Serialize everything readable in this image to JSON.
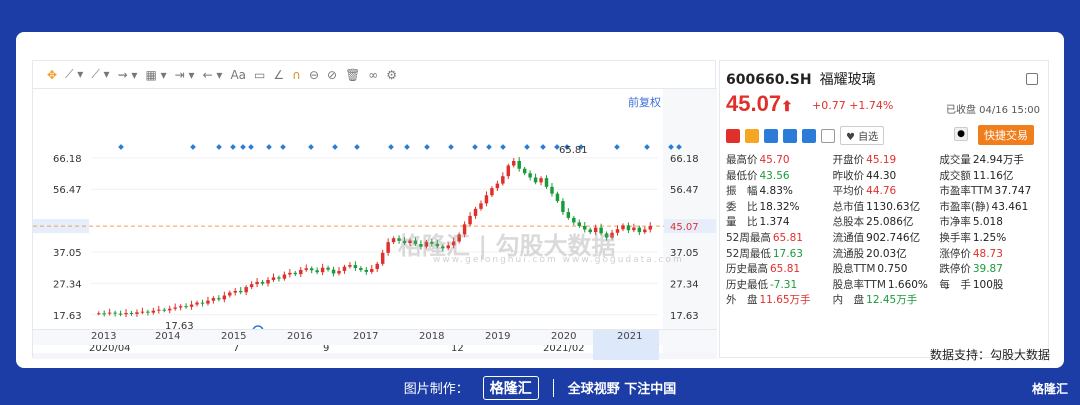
{
  "toolbar": {
    "items": [
      "✥",
      "⟋ ▾",
      "⟋ ▾",
      "⇝ ▾",
      "▦ ▾",
      "⇥ ▾",
      "← ▾",
      "Aa",
      "▭",
      "∠",
      "∩",
      "⊖",
      "⊘",
      "🗑",
      "∞",
      "⚙"
    ],
    "forward_adjust": "前复权"
  },
  "chart_data": {
    "type": "candlestick",
    "y_ticks": [
      "66.18",
      "56.47",
      "45.07",
      "37.05",
      "27.34",
      "17.63"
    ],
    "y_ticks_right": [
      "66.18",
      "56.47",
      "45.07",
      "37.05",
      "27.34",
      "17.63"
    ],
    "current_price_label": "45.07",
    "high_label": "65.81",
    "low_label": "17.63",
    "x_ticks": [
      "2020/04",
      "7",
      "9",
      "12",
      "2021/02"
    ],
    "timeline_years": [
      "2013",
      "2014",
      "2015",
      "2016",
      "2017",
      "2018",
      "2019",
      "2020",
      "2021"
    ],
    "ylim": [
      12,
      72
    ],
    "series": [
      {
        "close": [
          18.1,
          18.0,
          18.3,
          18.0,
          17.8,
          18.2,
          17.9,
          18.4,
          18.6,
          18.3,
          18.9,
          19.2,
          19.0,
          19.5,
          19.9,
          20.3,
          20.1,
          20.8,
          21.4,
          21.1,
          22.0,
          22.8,
          22.4,
          23.6,
          24.5,
          25.0,
          24.6,
          26.2,
          27.1,
          27.8,
          27.3,
          28.4,
          29.2,
          28.8,
          30.1,
          30.6,
          30.2,
          31.5,
          32.0,
          31.4,
          30.8,
          32.2,
          31.6,
          30.4,
          31.2,
          32.5,
          33.0,
          32.1,
          31.5,
          30.9,
          31.8,
          33.4,
          36.8,
          40.1,
          41.3,
          40.5,
          39.8,
          40.6,
          39.5,
          38.7,
          40.2,
          39.6,
          38.8,
          38.2,
          39.1,
          40.3,
          42.5,
          45.6,
          48.2,
          50.4,
          52.1,
          54.6,
          56.8,
          58.2,
          60.5,
          63.8,
          65.2,
          62.8,
          61.4,
          60.1,
          58.6,
          59.9,
          57.2,
          55.1,
          52.8,
          49.4,
          47.6,
          46.2,
          45.1,
          44.0,
          43.2,
          44.6,
          42.8,
          41.5,
          43.0,
          44.1,
          45.3,
          43.8,
          44.6,
          43.2,
          44.0,
          45.07
        ]
      }
    ]
  },
  "watermark": {
    "main": "格隆汇 | 勾股大数据",
    "sub": "www.gelonghui.com   www.gogudata.com"
  },
  "info": {
    "code": "600660.SH",
    "name": "福耀玻璃",
    "price": "45.07",
    "arrow": "⬆",
    "change": "+0.77",
    "change_pct": "+1.74%",
    "status": "已收盘 04/16 15:00",
    "watch_label": "♥ 自选",
    "trade_label": "快捷交易",
    "rows": [
      [
        [
          "最高价",
          "45.70",
          "red"
        ],
        [
          "开盘价",
          "45.19",
          "red"
        ],
        [
          "成交量",
          "24.94万手",
          "dark"
        ]
      ],
      [
        [
          "最低价",
          "43.56",
          "green"
        ],
        [
          "昨收价",
          "44.30",
          "dark"
        ],
        [
          "成交额",
          "11.16亿",
          "dark"
        ]
      ],
      [
        [
          "振　幅",
          "4.83%",
          "dark"
        ],
        [
          "平均价",
          "44.76",
          "red"
        ],
        [
          "市盈率TTM",
          "37.747",
          "dark"
        ]
      ],
      [
        [
          "委　比",
          "18.32%",
          "dark"
        ],
        [
          "总市值",
          "1130.63亿",
          "dark"
        ],
        [
          "市盈率(静)",
          "43.461",
          "dark"
        ]
      ],
      [
        [
          "量　比",
          "1.374",
          "dark"
        ],
        [
          "总股本",
          "25.086亿",
          "dark"
        ],
        [
          "市净率",
          "5.018",
          "dark"
        ]
      ],
      [
        [
          "52周最高",
          "65.81",
          "red"
        ],
        [
          "流通值",
          "902.746亿",
          "dark"
        ],
        [
          "换手率",
          "1.25%",
          "dark"
        ]
      ],
      [
        [
          "52周最低",
          "17.63",
          "green"
        ],
        [
          "流通股",
          "20.03亿",
          "dark"
        ],
        [
          "涨停价",
          "48.73",
          "red"
        ]
      ],
      [
        [
          "历史最高",
          "65.81",
          "red"
        ],
        [
          "股息TTM",
          "0.750",
          "dark"
        ],
        [
          "跌停价",
          "39.87",
          "green"
        ]
      ],
      [
        [
          "历史最低",
          "-7.31",
          "green"
        ],
        [
          "股息率TTM",
          "1.660%",
          "dark"
        ],
        [
          "每　手",
          "100股",
          "dark"
        ]
      ],
      [
        [
          "外　盘",
          "11.65万手",
          "red"
        ],
        [
          "内　盘",
          "12.45万手",
          "green"
        ],
        [
          "",
          "",
          "dark"
        ]
      ]
    ]
  },
  "data_source": "数据支持：勾股大数据",
  "footer": {
    "made_by": "图片制作：",
    "logo": "格隆汇",
    "slogan": "全球视野 下注中国",
    "corner": "格隆汇"
  }
}
